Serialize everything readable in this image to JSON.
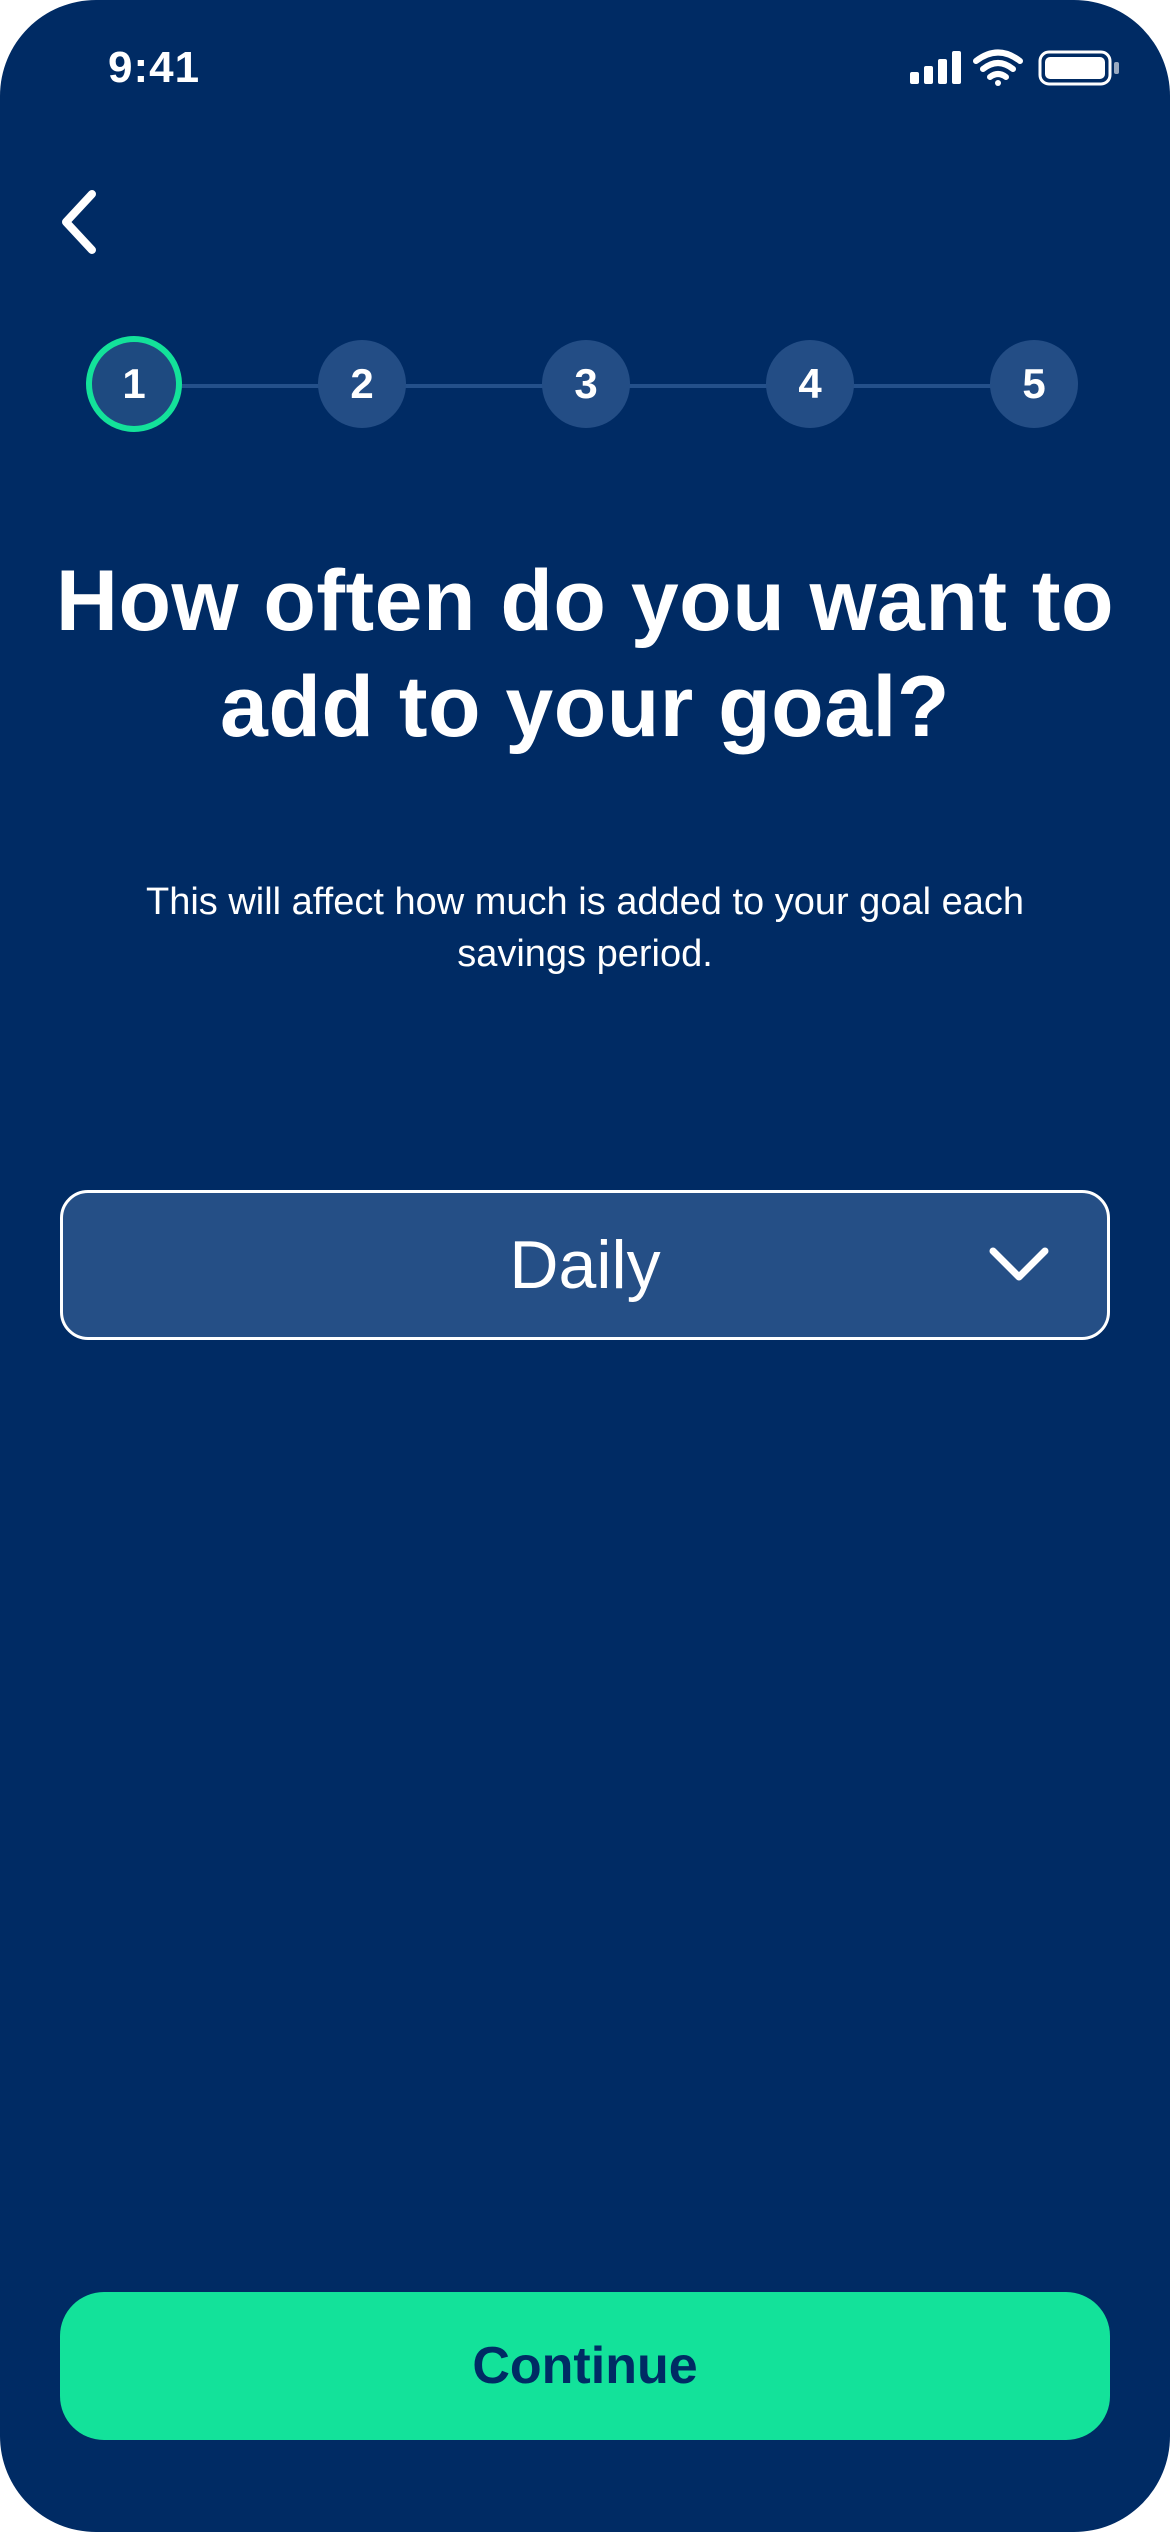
{
  "status_bar": {
    "time": "9:41",
    "icons": [
      "cellular-signal-icon",
      "wifi-icon",
      "battery-icon"
    ]
  },
  "nav": {
    "back_icon": "chevron-left-icon"
  },
  "stepper": {
    "current_step": 1,
    "steps": [
      "1",
      "2",
      "3",
      "4",
      "5"
    ]
  },
  "main": {
    "heading": "How often do you want to add to your goal?",
    "subtext": "This will affect how much is added to your goal each savings period."
  },
  "frequency_select": {
    "selected_value": "Daily",
    "icon": "chevron-down-icon"
  },
  "footer": {
    "continue_label": "Continue"
  },
  "colors": {
    "background": "#002B64",
    "accent": "#13E29A",
    "step_inactive": "#234D85",
    "field_background": "#254F86"
  }
}
